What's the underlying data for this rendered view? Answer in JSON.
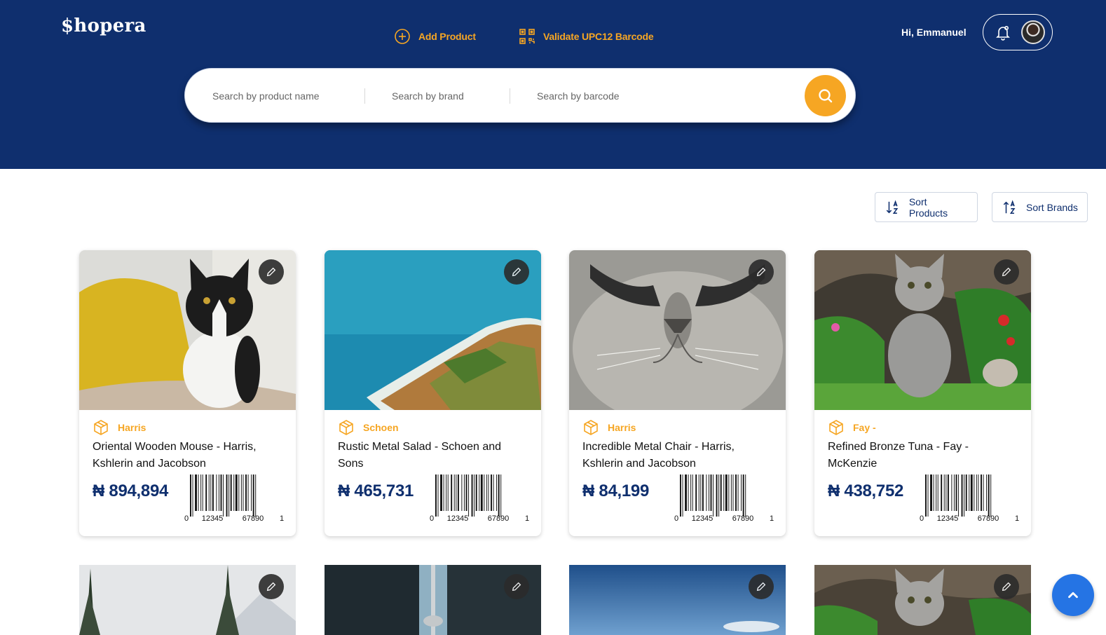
{
  "app": {
    "logo": "$hopera"
  },
  "nav": {
    "add_product": "Add Product",
    "validate": "Validate UPC12 Barcode"
  },
  "user": {
    "greeting": "Hi, Emmanuel"
  },
  "search": {
    "product_placeholder": "Search by product name",
    "brand_placeholder": "Search by brand",
    "barcode_placeholder": "Search by barcode"
  },
  "sort": {
    "products": "Sort Products",
    "brands": "Sort Brands"
  },
  "colors": {
    "header": "#0f2f6e",
    "accent": "#f6a623",
    "fab": "#2574e4"
  },
  "products": [
    {
      "brand": "Harris",
      "name": "Oriental Wooden Mouse - Harris, Kshlerin and Jacobson",
      "price": "₦ 894,894",
      "image": "cat-on-yellow-pillow"
    },
    {
      "brand": "Schoen",
      "name": "Rustic Metal Salad - Schoen and Sons",
      "price": "₦ 465,731",
      "image": "ocean-coastline-aerial"
    },
    {
      "brand": "Harris",
      "name": "Incredible Metal Chair - Harris, Kshlerin and Jacobson",
      "price": "₦ 84,199",
      "image": "cat-face-closeup"
    },
    {
      "brand": "Fay -",
      "name": "Refined Bronze Tuna - Fay - McKenzie",
      "price": "₦ 438,752",
      "image": "kitten-in-garden"
    }
  ],
  "products_row2": [
    {
      "image": "snowy-mountain-trees"
    },
    {
      "image": "cn-tower-buildings"
    },
    {
      "image": "blue-sky-horizon"
    },
    {
      "image": "kitten-in-garden"
    }
  ],
  "barcode": {
    "left": "0",
    "group1": "12345",
    "group2": "67890",
    "right": "1"
  }
}
